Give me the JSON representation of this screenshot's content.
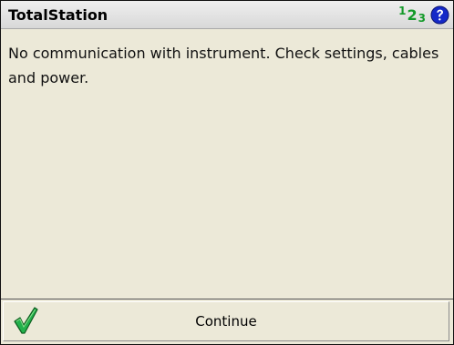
{
  "window": {
    "title": "TotalStation"
  },
  "status": {
    "input_mode": [
      "1",
      "2",
      "3"
    ],
    "input_mode_color": "#149a2a",
    "help_icon": "question-circle"
  },
  "message": {
    "text": "No communication with instrument. Check settings, cables and power."
  },
  "actions": {
    "continue_label": "Continue",
    "continue_icon": "green-checkmark"
  },
  "colors": {
    "background": "#ece9d8",
    "titlebar": "#e3e3e3",
    "help": "#1428c8",
    "check": "#22b14c"
  }
}
